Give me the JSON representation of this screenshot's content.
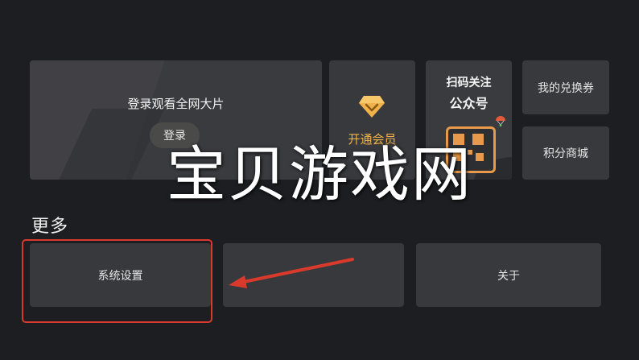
{
  "hero": {
    "login_prompt": "登录观看全网大片",
    "login_button": "登录"
  },
  "vip": {
    "label": "开通会员",
    "icon": "diamond-icon",
    "accent_color": "#f0b24a"
  },
  "qr_promo": {
    "line1": "扫码关注",
    "line2": "公众号",
    "icon": "qr-code-icon",
    "accent_color": "#e79a4b"
  },
  "side_buttons": {
    "coupons": "我的兑换券",
    "points_mall": "积分商城"
  },
  "more_section": {
    "title": "更多",
    "items": [
      "系统设置",
      "",
      "关于"
    ]
  },
  "annotation": {
    "highlight_color": "#d93a2b"
  },
  "watermark": "宝贝游戏网"
}
